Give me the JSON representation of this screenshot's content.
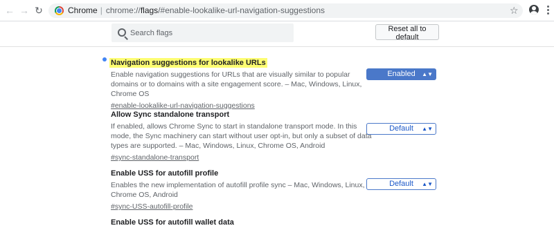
{
  "browser": {
    "omnibox_scheme": "Chrome",
    "omnibox_separator": "|",
    "omnibox_url_prefix": "chrome://",
    "omnibox_url_host": "flags",
    "omnibox_url_path": "/#enable-lookalike-url-navigation-suggestions",
    "icons": [
      "back-arrow-icon",
      "forward-arrow-icon",
      "reload-icon",
      "chrome-logo-icon",
      "star-icon",
      "account-icon",
      "menu-dots-icon"
    ]
  },
  "flags_page": {
    "search_placeholder": "Search flags",
    "reset_button_label": "Reset all to default"
  },
  "experiments": [
    {
      "title": "Navigation suggestions for lookalike URLs",
      "description": "Enable navigation suggestions for URLs that are visually similar to popular domains or to domains with a site engagement score. – Mac, Windows, Linux, Chrome OS",
      "link": "#enable-lookalike-url-navigation-suggestions",
      "state": "Enabled",
      "highlighted": true
    },
    {
      "title": "Allow Sync standalone transport",
      "description": "If enabled, allows Chrome Sync to start in standalone transport mode. In this mode, the Sync machinery can start without user opt-in, but only a subset of data types are supported. – Mac, Windows, Linux, Chrome OS, Android",
      "link": "#sync-standalone-transport",
      "state": "Default"
    },
    {
      "title": "Enable USS for autofill profile",
      "description": "Enables the new implementation of autofill profile sync – Mac, Windows, Linux, Chrome OS, Android",
      "link": "#sync-USS-autofill-profile",
      "state": "Default"
    },
    {
      "title": "Enable USS for autofill wallet data"
    }
  ],
  "colors": {
    "highlight": "#fdfd72",
    "accent_blue": "#4a78c9",
    "dot_blue": "#4285f4"
  }
}
